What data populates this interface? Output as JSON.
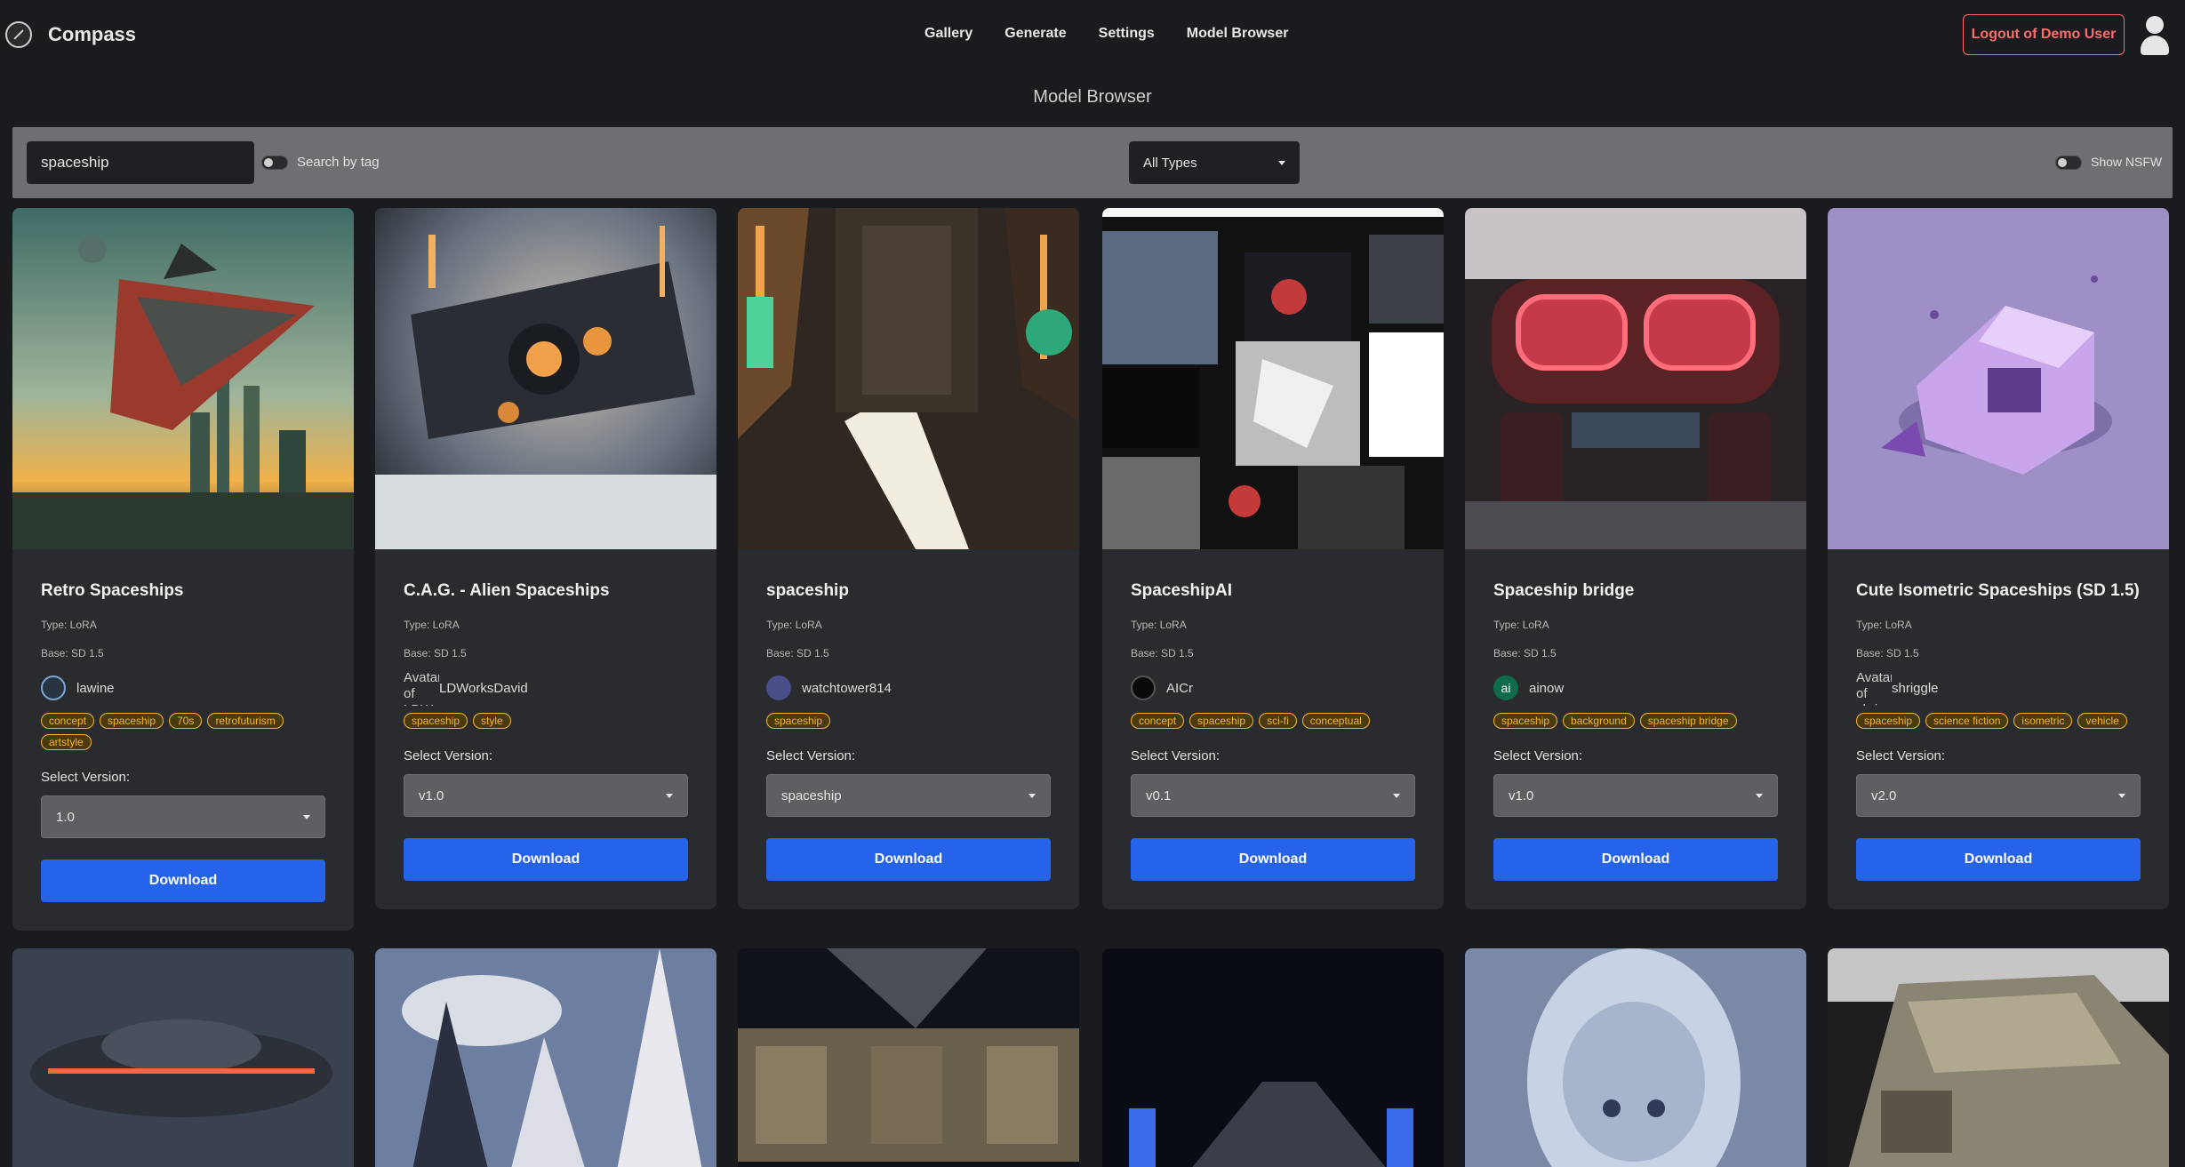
{
  "app": {
    "name": "Compass",
    "nav": [
      "Gallery",
      "Generate",
      "Settings",
      "Model Browser"
    ],
    "logout_label": "Logout of Demo User"
  },
  "page": {
    "title": "Model Browser"
  },
  "filters": {
    "search_value": "spaceship",
    "search_by_tag_label": "Search by tag",
    "type_select": "All Types",
    "show_nsfw_label": "Show NSFW"
  },
  "cards": [
    {
      "title": "Retro Spaceships",
      "type": "Type: LoRA",
      "base": "Base: SD 1.5",
      "creator": "lawine",
      "tags": [
        "concept",
        "spaceship",
        "70s",
        "retrofuturism",
        "artstyle"
      ],
      "version_label": "Select Version:",
      "version": "1.0",
      "download_label": "Download"
    },
    {
      "title": "C.A.G. - Alien Spaceships",
      "type": "Type: LoRA",
      "base": "Base: SD 1.5",
      "creator": "LDWorksDavid",
      "avatar_fallback": "Avatar of LDWorksDavid",
      "tags": [
        "spaceship",
        "style"
      ],
      "version_label": "Select Version:",
      "version": "v1.0",
      "download_label": "Download"
    },
    {
      "title": "spaceship",
      "type": "Type: LoRA",
      "base": "Base: SD 1.5",
      "creator": "watchtower814",
      "tags": [
        "spaceship"
      ],
      "version_label": "Select Version:",
      "version": "spaceship",
      "download_label": "Download"
    },
    {
      "title": "SpaceshipAI",
      "type": "Type: LoRA",
      "base": "Base: SD 1.5",
      "creator": "AICr",
      "tags": [
        "concept",
        "spaceship",
        "sci-fi",
        "conceptual"
      ],
      "version_label": "Select Version:",
      "version": "v0.1",
      "download_label": "Download"
    },
    {
      "title": "Spaceship bridge",
      "type": "Type: LoRA",
      "base": "Base: SD 1.5",
      "creator": "ainow",
      "tags": [
        "spaceship",
        "background",
        "spaceship bridge"
      ],
      "version_label": "Select Version:",
      "version": "v1.0",
      "download_label": "Download"
    },
    {
      "title": "Cute Isometric Spaceships (SD 1.5)",
      "type": "Type: LoRA",
      "base": "Base: SD 1.5",
      "creator": "shriggle",
      "avatar_fallback": "Avatar of shriggle",
      "tags": [
        "spaceship",
        "science fiction",
        "isometric",
        "vehicle"
      ],
      "version_label": "Select Version:",
      "version": "v2.0",
      "download_label": "Download"
    }
  ],
  "icons": {
    "brand": "compass-icon",
    "user": "user-avatar-icon",
    "dropdown": "chevron-down-icon"
  },
  "colors": {
    "background": "#1a1b1e",
    "card": "#2a2b2e",
    "accent": "#2563eb",
    "logout": "#ff6b6b",
    "tag": "#f5b62a"
  }
}
